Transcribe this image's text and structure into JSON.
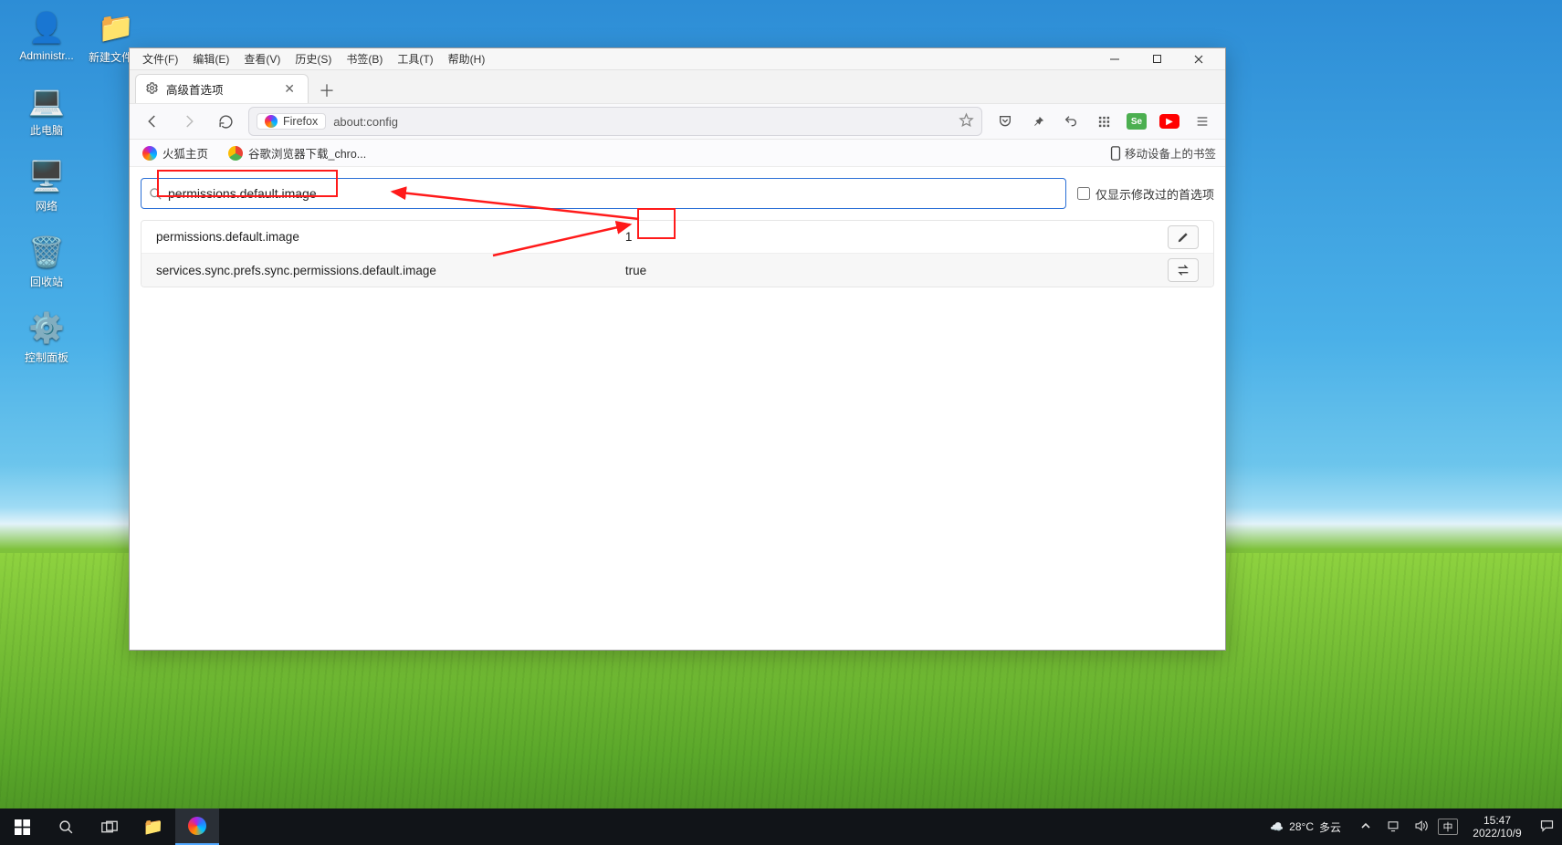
{
  "desktop": {
    "icons": [
      {
        "label": "Administr...",
        "glyph": "👤"
      },
      {
        "label": "此电脑",
        "glyph": "💻"
      },
      {
        "label": "网络",
        "glyph": "🖥️"
      },
      {
        "label": "回收站",
        "glyph": "🗑️"
      },
      {
        "label": "控制面板",
        "glyph": "⚙️"
      }
    ],
    "icon_right": {
      "label": "新建文件夹",
      "glyph": "📁"
    }
  },
  "window": {
    "menus": [
      "文件(F)",
      "编辑(E)",
      "查看(V)",
      "历史(S)",
      "书签(B)",
      "工具(T)",
      "帮助(H)"
    ],
    "tab": {
      "title": "高级首选项"
    },
    "url": {
      "chip": "Firefox",
      "address": "about:config"
    },
    "bookmarks": {
      "left": [
        {
          "label": "火狐主页",
          "icon_color": "#ff7b00"
        },
        {
          "label": "谷歌浏览器下载_chro...",
          "icon_color": "#1a73e8"
        }
      ],
      "right": "移动设备上的书签"
    },
    "config": {
      "search_value": "permissions.default.image",
      "show_modified_label": "仅显示修改过的首选项",
      "show_modified_checked": false,
      "rows": [
        {
          "name": "permissions.default.image",
          "value": "1",
          "action": "edit"
        },
        {
          "name": "services.sync.prefs.sync.permissions.default.image",
          "value": "true",
          "action": "toggle"
        }
      ]
    }
  },
  "taskbar": {
    "weather": {
      "temp": "28°C",
      "cond": "多云"
    },
    "ime": "中",
    "time": "15:47",
    "date": "2022/10/9"
  }
}
